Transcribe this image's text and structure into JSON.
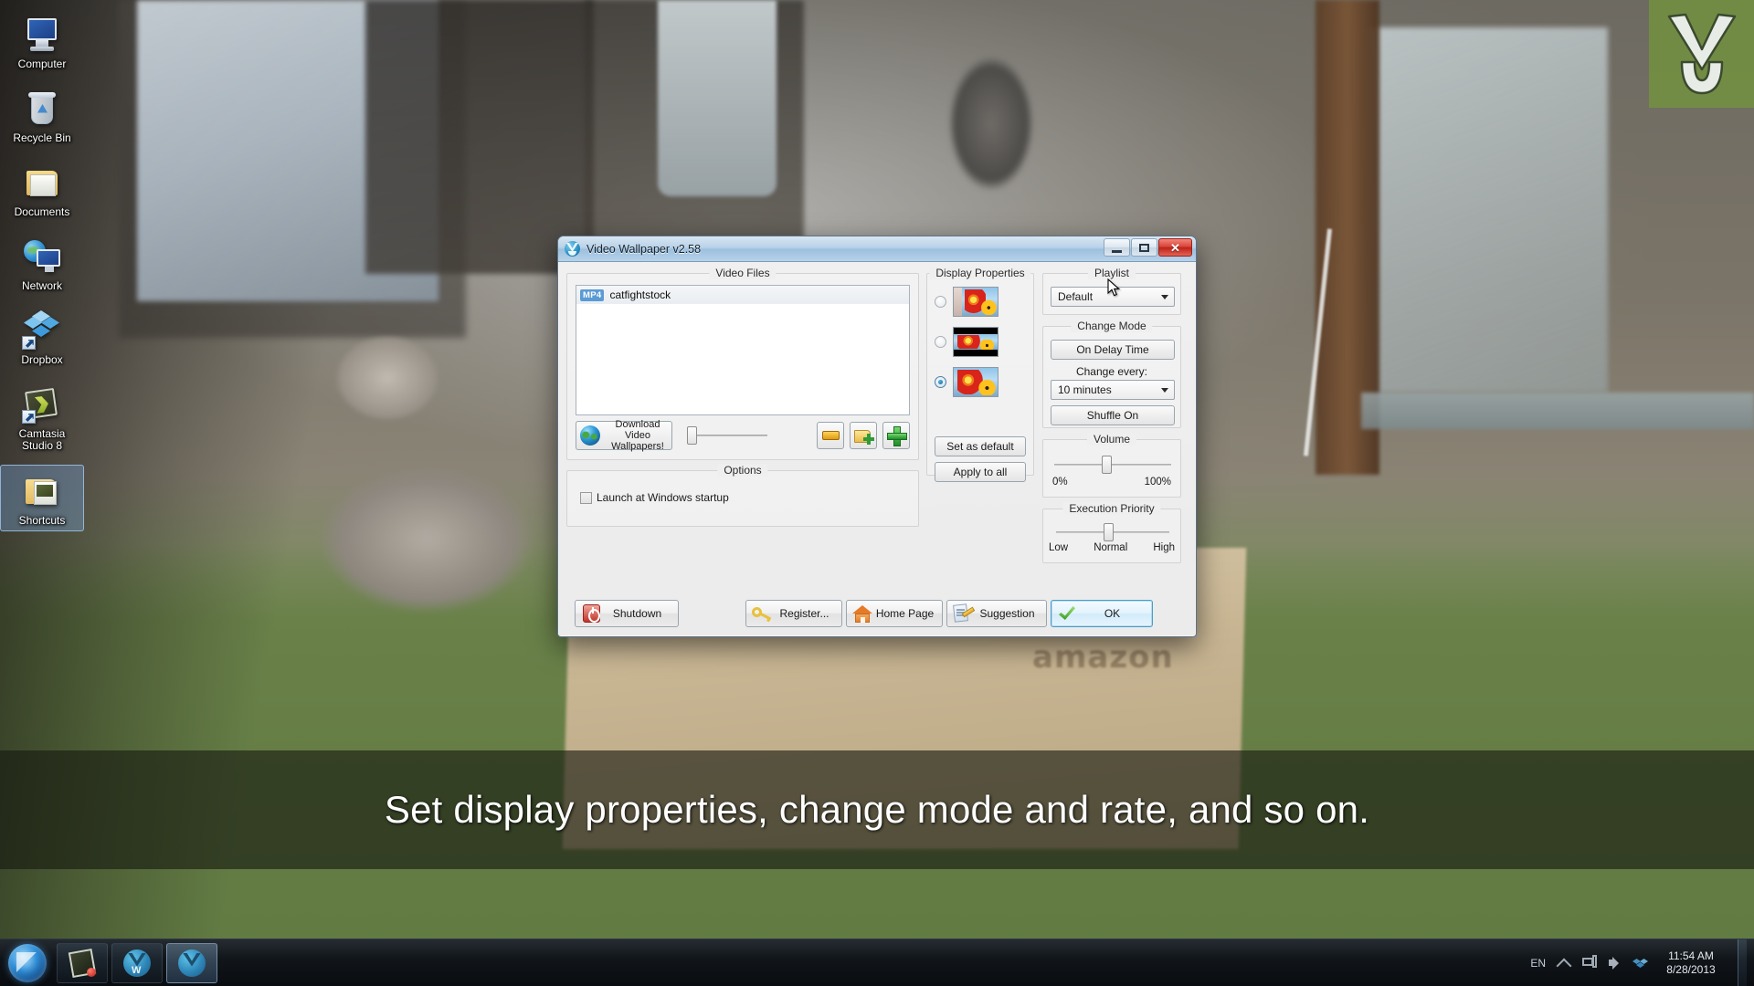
{
  "desktop": {
    "icons": [
      {
        "label": "Computer",
        "icon": "computer-icon",
        "selected": false
      },
      {
        "label": "Recycle Bin",
        "icon": "recycle-bin-icon",
        "selected": false
      },
      {
        "label": "Documents",
        "icon": "documents-folder-icon",
        "selected": false
      },
      {
        "label": "Network",
        "icon": "network-icon",
        "selected": false
      },
      {
        "label": "Dropbox",
        "icon": "dropbox-icon",
        "selected": false
      },
      {
        "label": "Camtasia Studio 8",
        "icon": "camtasia-icon",
        "selected": false
      },
      {
        "label": "Shortcuts",
        "icon": "shortcuts-folder-icon",
        "selected": true
      }
    ],
    "background_watermark": "chevron-logo-watermark"
  },
  "caption": {
    "text": "Set display properties, change mode and rate, and so on."
  },
  "taskbar": {
    "start_button": "windows-start-orb",
    "buttons": [
      {
        "name": "camtasia-taskbar-button",
        "active": false
      },
      {
        "name": "video-wallpaper-w-taskbar-button",
        "active": false
      },
      {
        "name": "video-wallpaper-taskbar-button",
        "active": true
      }
    ],
    "tray": {
      "language": "EN",
      "icons": [
        "show-hidden-icons",
        "network-icon",
        "volume-icon",
        "dropbox-tray-icon"
      ],
      "time": "11:54 AM",
      "date": "8/28/2013"
    }
  },
  "dialog": {
    "title": "Video Wallpaper  v2.58",
    "window_buttons": {
      "minimize": "minimize-icon",
      "maximize": "maximize-icon",
      "close": "close-icon"
    },
    "video_files": {
      "group_title": "Video Files",
      "items": [
        {
          "badge": "MP4",
          "name": "catfightstock"
        }
      ],
      "download_button": {
        "line1": "Download Video",
        "line2": "Wallpapers!"
      },
      "opacity_slider_value": 0,
      "buttons": [
        {
          "name": "remove-file-button",
          "icon": "orange-minus-icon"
        },
        {
          "name": "add-folder-button",
          "icon": "folder-plus-icon"
        },
        {
          "name": "add-file-button",
          "icon": "green-plus-icon"
        }
      ]
    },
    "options": {
      "group_title": "Options",
      "launch_at_startup_label": "Launch at Windows startup",
      "launch_at_startup_checked": false
    },
    "display_properties": {
      "group_title": "Display Properties",
      "modes": [
        {
          "name": "center-mode",
          "selected": false
        },
        {
          "name": "letterbox-mode",
          "selected": false
        },
        {
          "name": "stretch-mode",
          "selected": true
        }
      ],
      "set_as_default_label": "Set as default",
      "apply_to_all_label": "Apply to all"
    },
    "playlist": {
      "group_title": "Playlist",
      "selected": "Default"
    },
    "change_mode": {
      "group_title": "Change Mode",
      "mode_button_label": "On Delay Time",
      "change_every_label": "Change every:",
      "interval_selected": "10 minutes",
      "shuffle_button_label": "Shuffle On"
    },
    "volume": {
      "group_title": "Volume",
      "min_label": "0%",
      "max_label": "100%",
      "value": 42
    },
    "execution_priority": {
      "group_title": "Execution Priority",
      "labels": [
        "Low",
        "Normal",
        "High"
      ],
      "value": "Normal"
    },
    "buttons": {
      "shutdown": "Shutdown",
      "register": "Register...",
      "home_page": "Home Page",
      "suggestion": "Suggestion",
      "ok": "OK"
    }
  }
}
